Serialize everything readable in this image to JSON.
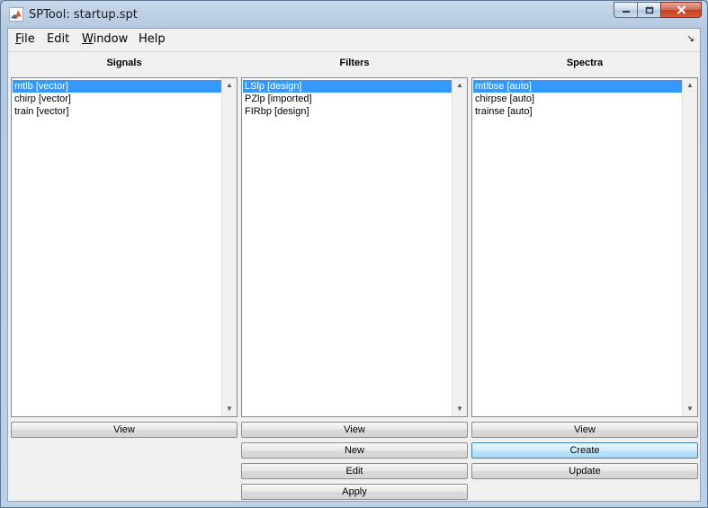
{
  "window": {
    "title": "SPTool: startup.spt",
    "controls": {
      "minimize": "minimize",
      "maximize": "maximize",
      "close": "close"
    }
  },
  "menu": {
    "items": [
      {
        "label": "File"
      },
      {
        "label": "Edit"
      },
      {
        "label": "Window"
      },
      {
        "label": "Help"
      }
    ],
    "dock_icon": "dock-arrow-icon"
  },
  "signals": {
    "title": "Signals",
    "items": [
      "mtlb [vector]",
      "chirp [vector]",
      "train [vector]"
    ],
    "selected": "mtlb [vector]",
    "buttons": {
      "view": "View"
    }
  },
  "filters": {
    "title": "Filters",
    "items": [
      "LSlp [design]",
      "PZlp [imported]",
      "FIRbp [design]"
    ],
    "selected": "LSlp [design]",
    "buttons": {
      "view": "View",
      "new": "New",
      "edit": "Edit",
      "apply": "Apply"
    }
  },
  "spectra": {
    "title": "Spectra",
    "items": [
      "mtlbse [auto]",
      "chirpse [auto]",
      "trainse [auto]"
    ],
    "selected": "mtlbse [auto]",
    "buttons": {
      "view": "View",
      "create": "Create",
      "update": "Update"
    }
  },
  "colors": {
    "selection": "#3399ff",
    "focused_button": "#bee6fb"
  }
}
